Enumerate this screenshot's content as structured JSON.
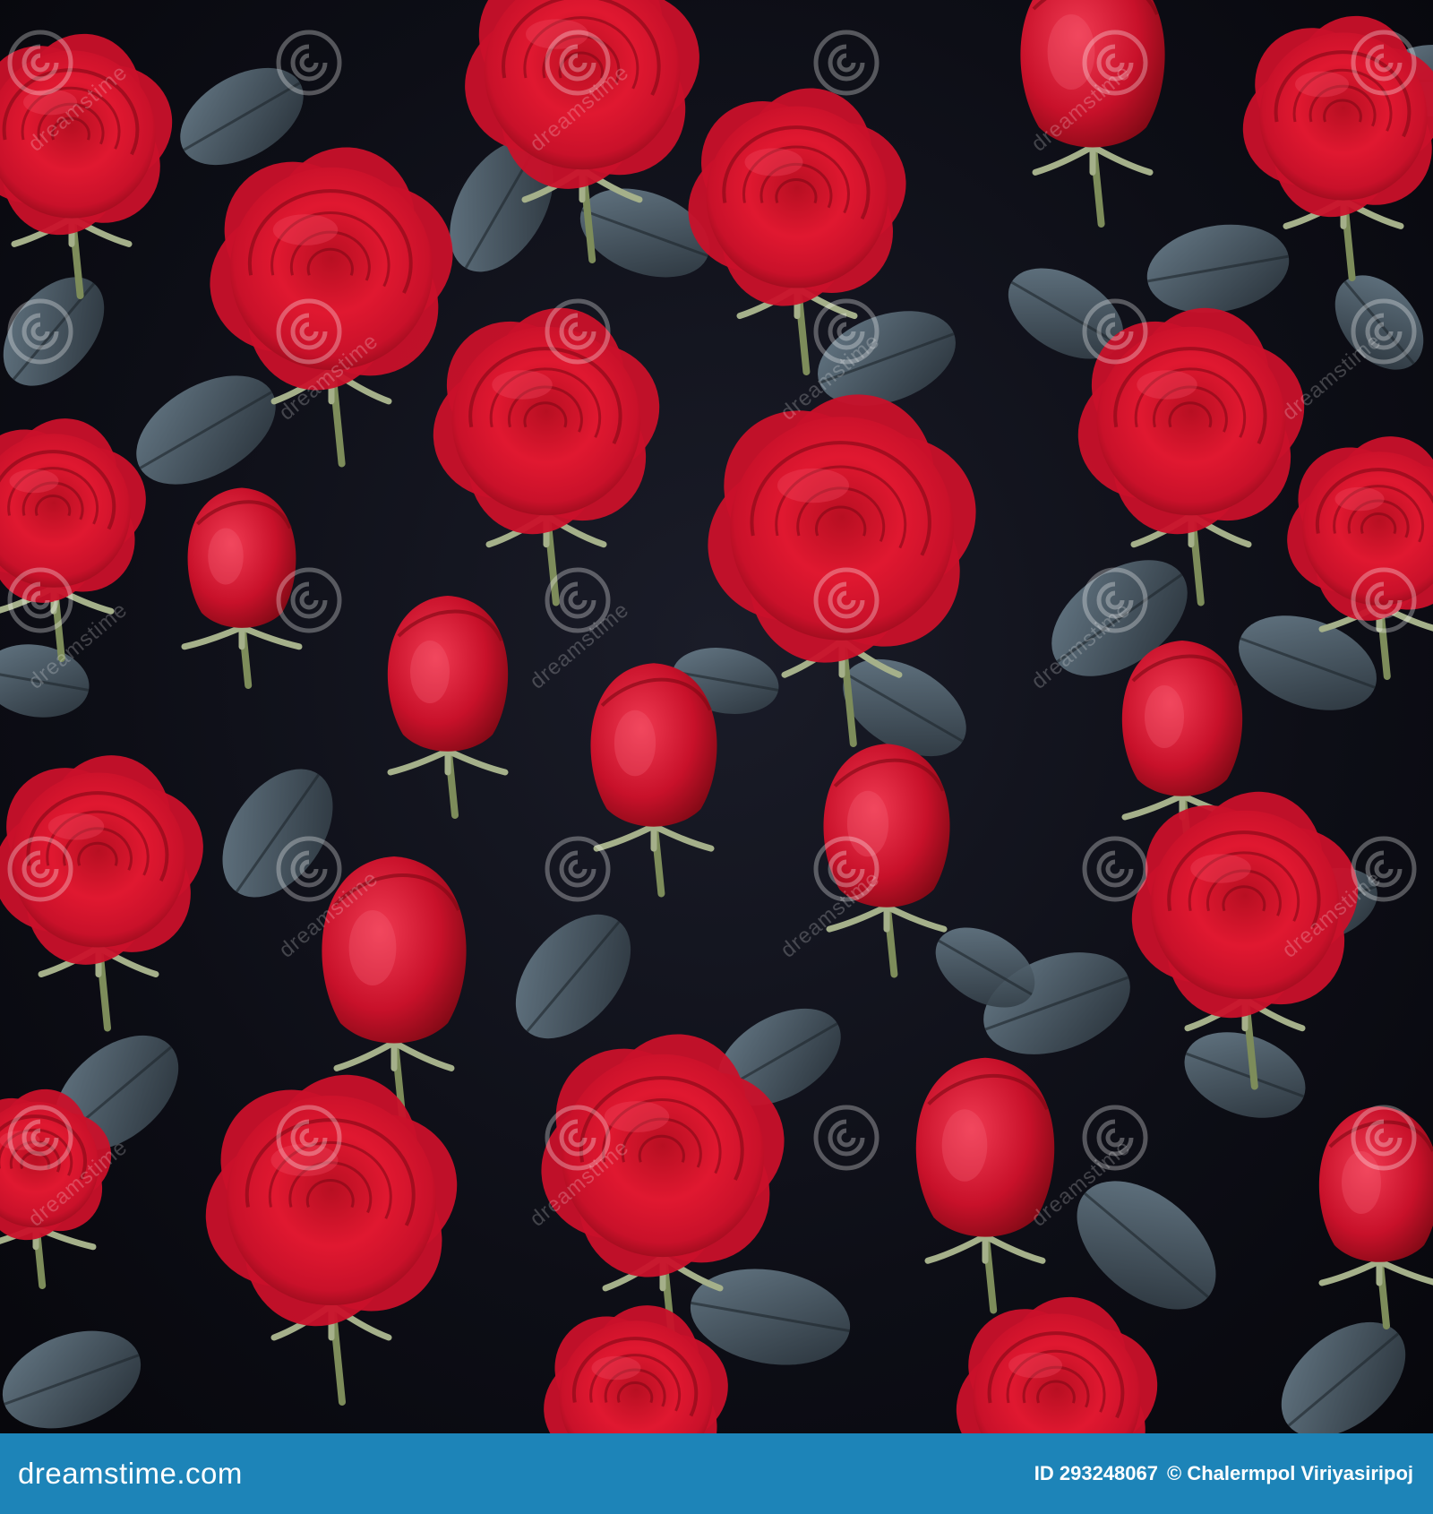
{
  "photo": {
    "subject": "red roses with blue-grey leaves on dark background",
    "colors": {
      "background": "#0c0d14",
      "rose": "#d8152c",
      "rose_dark": "#8e0a1a",
      "leaf": "#45545f",
      "footer": "#1d84b8"
    }
  },
  "watermark": {
    "text": "dreamstime"
  },
  "footer": {
    "brand": "dreamstime.com",
    "image_id": "ID 293248067",
    "credit": "© Chalermpol Viriyasiripoj"
  }
}
